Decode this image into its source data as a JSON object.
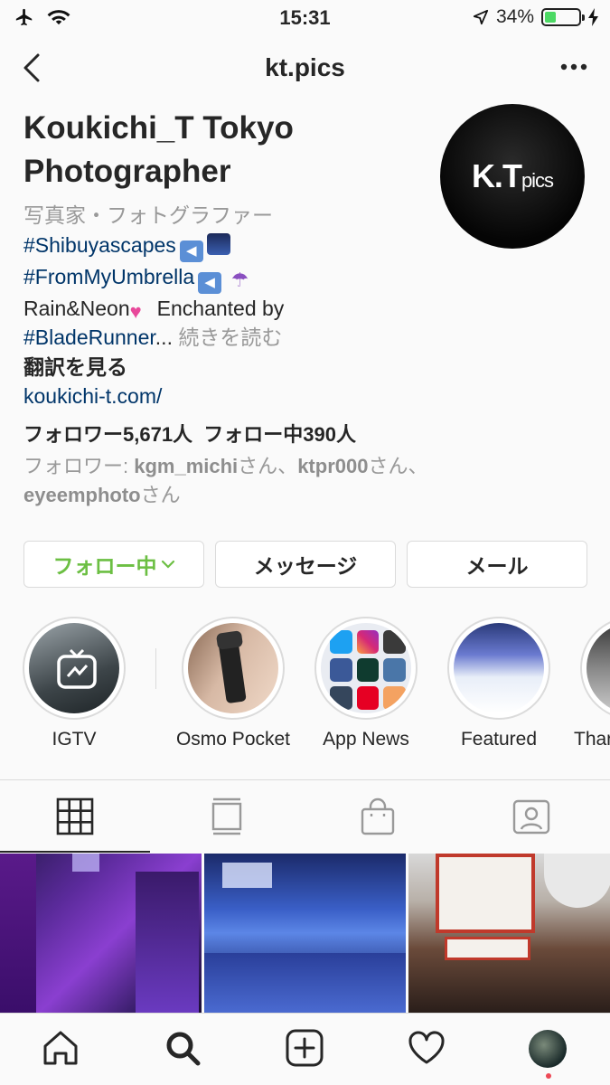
{
  "status_bar": {
    "time": "15:31",
    "battery": "34%",
    "battery_level": 0.34
  },
  "header": {
    "title": "kt.pics"
  },
  "profile": {
    "name": "Koukichi_T Tokyo Photographer",
    "avatar_logo": "K.T",
    "avatar_logo_small": "pics",
    "bio_line1": "写真家・フォトグラファー",
    "bio_tag1": "#Shibuyascapes",
    "bio_tag2": "#FromMyUmbrella",
    "bio_line4": "Rain&Neon",
    "bio_line4b": "Enchanted by",
    "bio_tag3": "#BladeRunner",
    "bio_ellipsis": "...",
    "bio_more": "続きを読む",
    "translate": "翻訳を見る",
    "link": "koukichi-t.com/",
    "followers": "フォロワー5,671人",
    "following": "フォロー中390人",
    "followed_prefix": "フォロワー: ",
    "followed_user1": "kgm_michi",
    "followed_sep1": "さん、",
    "followed_user2": "ktpr000",
    "followed_sep2": "さん、",
    "followed_user3": "eyeemphoto",
    "followed_suffix": "さん"
  },
  "buttons": {
    "following": "フォロー中",
    "message": "メッセージ",
    "email": "メール"
  },
  "highlights": [
    {
      "label": "IGTV"
    },
    {
      "label": "Osmo Pocket"
    },
    {
      "label": "App News"
    },
    {
      "label": "Featured"
    },
    {
      "label": "Thar"
    }
  ],
  "colors": {
    "link": "#003569",
    "following_green": "#6cbf43",
    "border": "#dbdbdb"
  }
}
